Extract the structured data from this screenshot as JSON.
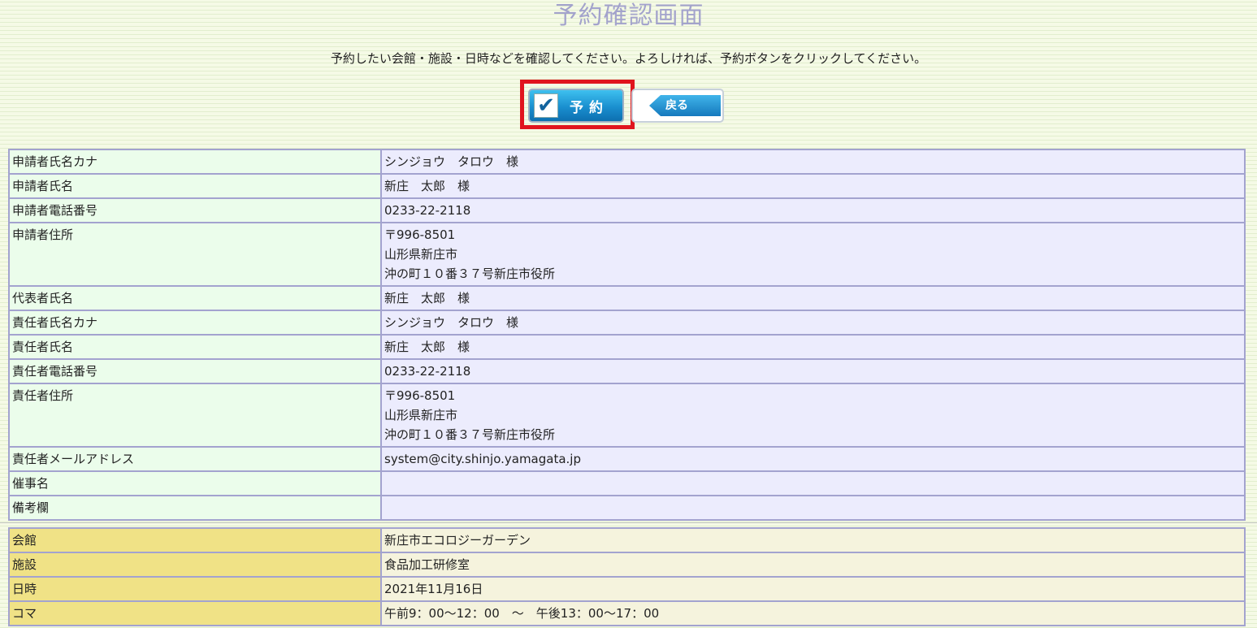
{
  "title": "予約確認画面",
  "instruction": "予約したい会館・施設・日時などを確認してください。よろしければ、予約ボタンをクリックしてください。",
  "buttons": {
    "reserve_label": "予約",
    "back_label": "戻る"
  },
  "applicant": [
    {
      "label": "申請者氏名カナ",
      "value": "シンジョウ　タロウ　様"
    },
    {
      "label": "申請者氏名",
      "value": "新庄　太郎　様"
    },
    {
      "label": "申請者電話番号",
      "value": "0233-22-2118"
    },
    {
      "label": "申請者住所",
      "lines": [
        "〒996-8501",
        "山形県新庄市",
        "沖の町１０番３７号新庄市役所"
      ]
    },
    {
      "label": "代表者氏名",
      "value": "新庄　太郎　様"
    },
    {
      "label": "責任者氏名カナ",
      "value": "シンジョウ　タロウ　様"
    },
    {
      "label": "責任者氏名",
      "value": "新庄　太郎　様"
    },
    {
      "label": "責任者電話番号",
      "value": "0233-22-2118"
    },
    {
      "label": "責任者住所",
      "lines": [
        "〒996-8501",
        "山形県新庄市",
        "沖の町１０番３７号新庄市役所"
      ]
    },
    {
      "label": "責任者メールアドレス",
      "value": "system@city.shinjo.yamagata.jp"
    },
    {
      "label": "催事名",
      "value": ""
    },
    {
      "label": "備考欄",
      "value": ""
    }
  ],
  "facility": [
    {
      "label": "会館",
      "value": "新庄市エコロジーガーデン"
    },
    {
      "label": "施設",
      "value": "食品加工研修室"
    },
    {
      "label": "日時",
      "value": "2021年11月16日"
    },
    {
      "label": "コマ",
      "value": "午前9：00～12：00　～　午後13：00～17：00"
    }
  ],
  "colors": {
    "highlight": "#e0141e",
    "button_blue": "#1a8fcf",
    "applicant_label_bg": "#ebfdeb",
    "applicant_value_bg": "#ececfd",
    "facility_label_bg": "#f0e286",
    "facility_value_bg": "#f5f3dd"
  },
  "icons": {
    "reserve": "checkmark-icon",
    "back": "back-arrow-tag-icon"
  }
}
